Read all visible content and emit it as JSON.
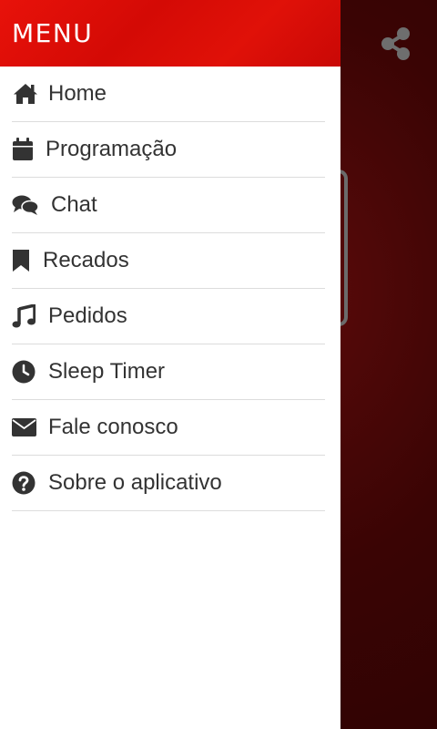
{
  "drawer": {
    "title": "MENU",
    "items": [
      {
        "label": "Home",
        "icon": "home-icon"
      },
      {
        "label": "Programação",
        "icon": "calendar-icon"
      },
      {
        "label": "Chat",
        "icon": "chat-icon"
      },
      {
        "label": "Recados",
        "icon": "bookmark-icon"
      },
      {
        "label": "Pedidos",
        "icon": "music-note-icon"
      },
      {
        "label": "Sleep Timer",
        "icon": "clock-icon"
      },
      {
        "label": "Fale conosco",
        "icon": "envelope-icon"
      },
      {
        "label": "Sobre o aplicativo",
        "icon": "question-circle-icon"
      }
    ]
  },
  "background": {
    "share_icon": "share-icon"
  },
  "colors": {
    "header_red": "#e8120a",
    "text": "#333333",
    "background_dark_red": "#3a0404"
  }
}
